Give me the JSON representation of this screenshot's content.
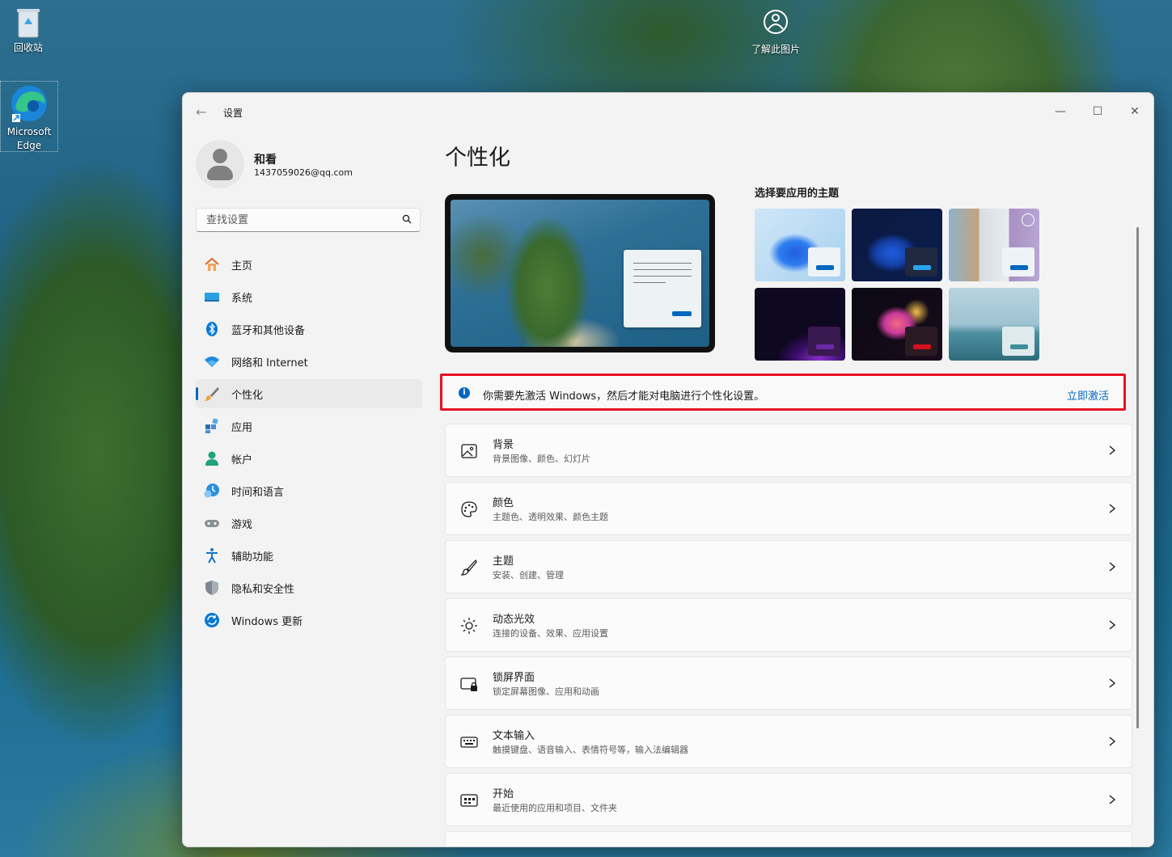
{
  "desktop": {
    "icons": [
      {
        "label": "回收站",
        "icon": "recycle-bin-icon"
      },
      {
        "label": "Microsoft Edge",
        "icon": "edge-icon"
      },
      {
        "label": "了解此图片",
        "icon": "learn-about-picture-icon"
      }
    ]
  },
  "window": {
    "title": "设置",
    "controls": {
      "minimize": "—",
      "maximize": "☐",
      "close": "✕"
    }
  },
  "user": {
    "name": "和看",
    "email": "1437059026@qq.com"
  },
  "search": {
    "placeholder": "查找设置"
  },
  "sidebar": {
    "items": [
      {
        "label": "主页",
        "icon": "home-icon"
      },
      {
        "label": "系统",
        "icon": "system-icon"
      },
      {
        "label": "蓝牙和其他设备",
        "icon": "bluetooth-icon"
      },
      {
        "label": "网络和 Internet",
        "icon": "network-icon"
      },
      {
        "label": "个性化",
        "icon": "personalization-icon",
        "active": true
      },
      {
        "label": "应用",
        "icon": "apps-icon"
      },
      {
        "label": "帐户",
        "icon": "account-icon"
      },
      {
        "label": "时间和语言",
        "icon": "time-language-icon"
      },
      {
        "label": "游戏",
        "icon": "gaming-icon"
      },
      {
        "label": "辅助功能",
        "icon": "accessibility-icon"
      },
      {
        "label": "隐私和安全性",
        "icon": "privacy-icon"
      },
      {
        "label": "Windows 更新",
        "icon": "windows-update-icon"
      }
    ]
  },
  "main": {
    "title": "个性化",
    "themes_label": "选择要应用的主题",
    "notice": {
      "text": "你需要先激活 Windows，然后才能对电脑进行个性化设置。",
      "link": "立即激活"
    },
    "rows": [
      {
        "title": "背景",
        "subtitle": "背景图像、颜色、幻灯片",
        "icon": "background-image-icon"
      },
      {
        "title": "颜色",
        "subtitle": "主题色、透明效果、颜色主题",
        "icon": "palette-icon"
      },
      {
        "title": "主题",
        "subtitle": "安装、创建、管理",
        "icon": "brush-icon"
      },
      {
        "title": "动态光效",
        "subtitle": "连接的设备、效果、应用设置",
        "icon": "dynamic-lighting-icon"
      },
      {
        "title": "锁屏界面",
        "subtitle": "锁定屏幕图像、应用和动画",
        "icon": "lock-screen-icon"
      },
      {
        "title": "文本输入",
        "subtitle": "触摸键盘、语音输入、表情符号等，输入法编辑器",
        "icon": "keyboard-icon"
      },
      {
        "title": "开始",
        "subtitle": "最近使用的应用和项目、文件夹",
        "icon": "start-icon"
      }
    ]
  },
  "colors": {
    "accent": "#0067c0",
    "highlight_border": "#e81123"
  }
}
